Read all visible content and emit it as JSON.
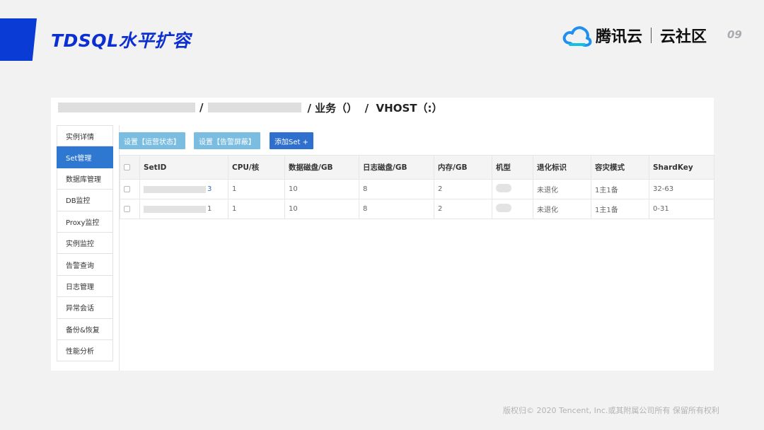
{
  "slide": {
    "title": "TDSQL水平扩容",
    "page": "09"
  },
  "logo": {
    "brand1": "腾讯云",
    "brand2": "云社区",
    "icon": "tencent-cloud-icon",
    "colors": [
      "#1f8ff0",
      "#12c0e0"
    ]
  },
  "breadcrumb": {
    "sep1": "/",
    "rest": "/ 业务（）  /  VHOST（:）"
  },
  "sidebar": {
    "items": [
      {
        "label": "实例详情",
        "active": false
      },
      {
        "label": "Set管理",
        "active": true
      },
      {
        "label": "数据库管理",
        "active": false
      },
      {
        "label": "DB监控",
        "active": false
      },
      {
        "label": "Proxy监控",
        "active": false
      },
      {
        "label": "实例监控",
        "active": false
      },
      {
        "label": "告警查询",
        "active": false
      },
      {
        "label": "日志管理",
        "active": false
      },
      {
        "label": "异常会话",
        "active": false
      },
      {
        "label": "备份&恢复",
        "active": false
      },
      {
        "label": "性能分析",
        "active": false
      }
    ]
  },
  "toolbar": {
    "btn1": "设置【运营状态】",
    "btn2": "设置【告警屏蔽】",
    "btn3": "添加Set +"
  },
  "table": {
    "headers": [
      "SetID",
      "CPU/核",
      "数据磁盘/GB",
      "日志磁盘/GB",
      "内存/GB",
      "机型",
      "退化标识",
      "容灾模式",
      "ShardKey"
    ],
    "rows": [
      {
        "id_suffix": "3",
        "cpu": "1",
        "data_disk": "10",
        "log_disk": "8",
        "mem": "2",
        "degrade": "未退化",
        "dr_mode": "1主1备",
        "shardkey": "32-63"
      },
      {
        "id_suffix": "1",
        "cpu": "1",
        "data_disk": "10",
        "log_disk": "8",
        "mem": "2",
        "degrade": "未退化",
        "dr_mode": "1主1备",
        "shardkey": "0-31"
      }
    ]
  },
  "footer": {
    "copyright": "版权归© 2020 Tencent, Inc.或其附属公司所有 保留所有权利"
  },
  "colors": {
    "title_blue": "#0b2fd0",
    "accent_bar": "#0a3bd4",
    "active_tab": "#2e78d1",
    "btn_light": "#7bbde0",
    "btn_primary": "#2f70cf"
  }
}
